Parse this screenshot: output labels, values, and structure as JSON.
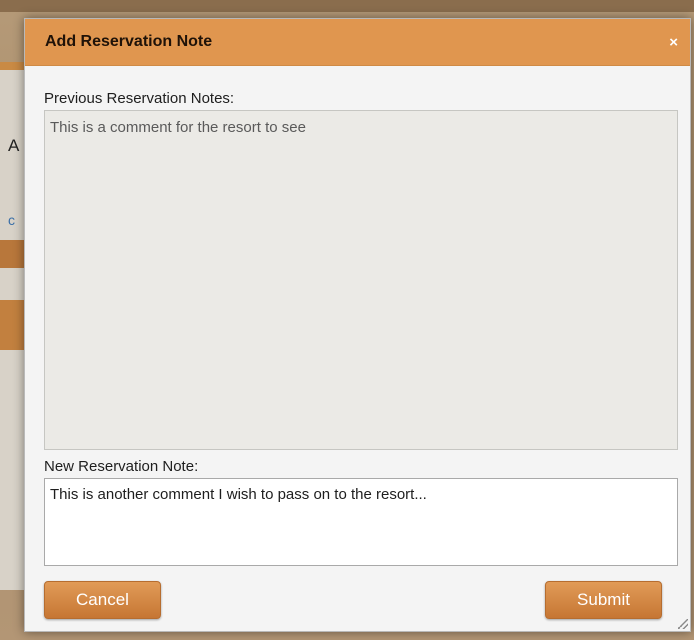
{
  "background": {
    "partial_letter": "A",
    "partial_link": "c"
  },
  "modal": {
    "title": "Add Reservation Note",
    "close_icon": "×",
    "previous_label": "Previous Reservation Notes:",
    "previous_notes": "This is a comment for the resort to see",
    "new_label": "New Reservation Note:",
    "new_note_value": "This is another comment I wish to pass on to the resort...",
    "cancel_label": "Cancel",
    "submit_label": "Submit"
  },
  "colors": {
    "header": "#e0964f",
    "button": "#d0853f",
    "dialog_bg": "#f4f4f4"
  }
}
